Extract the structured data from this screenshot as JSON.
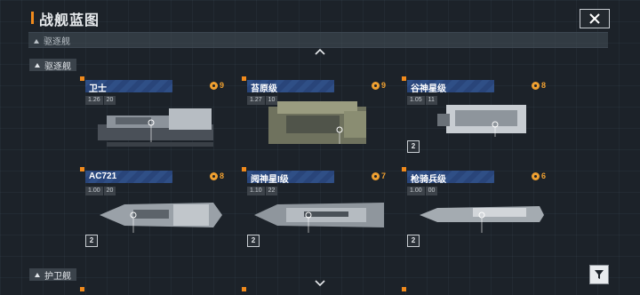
{
  "window": {
    "title": "战舰蓝图"
  },
  "filter": {
    "label": "驱逐舰"
  },
  "sections": [
    {
      "label": "驱逐舰"
    },
    {
      "label": "护卫舰"
    }
  ],
  "cards": [
    {
      "name": "卫士",
      "rank": "9",
      "ver_a": "1.26",
      "ver_b": "20",
      "tier_badge": ""
    },
    {
      "name": "苔原级",
      "rank": "9",
      "ver_a": "1.27",
      "ver_b": "10",
      "tier_badge": ""
    },
    {
      "name": "谷神星级",
      "rank": "8",
      "ver_a": "1.05",
      "ver_b": "11",
      "tier_badge": "2"
    },
    {
      "name": "AC721",
      "rank": "8",
      "ver_a": "1.00",
      "ver_b": "20",
      "tier_badge": "2"
    },
    {
      "name": "阋神星I级",
      "rank": "7",
      "ver_a": "1.10",
      "ver_b": "22",
      "tier_badge": "2"
    },
    {
      "name": "枪骑兵级",
      "rank": "6",
      "ver_a": "1.00",
      "ver_b": "00",
      "tier_badge": "2"
    }
  ],
  "icons": [
    "close-icon",
    "chevron-up-icon",
    "chevron-down-icon",
    "filter-icon",
    "rank-icon",
    "triangle-icon",
    "tier-badge-icon"
  ],
  "colors": {
    "accent": "#f08a1c",
    "name_bar": "#2f4f86",
    "rank": "#f0a030",
    "background": "#1c2229"
  }
}
